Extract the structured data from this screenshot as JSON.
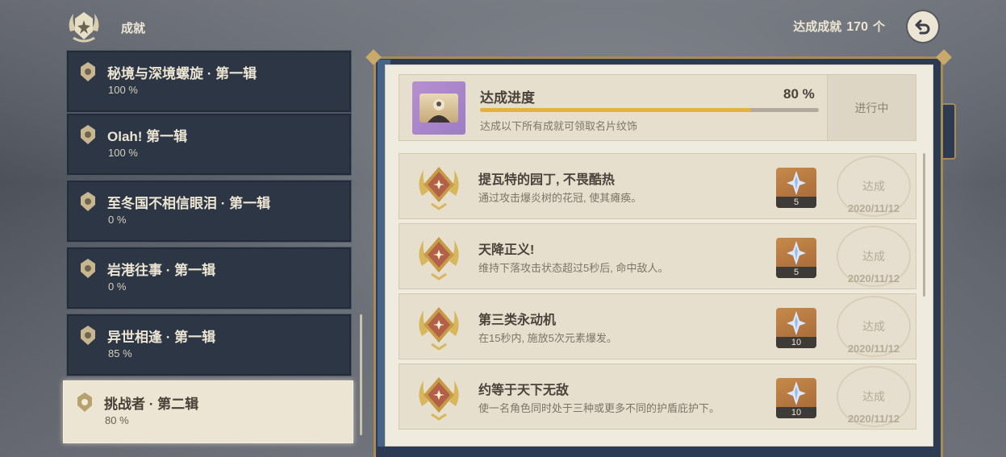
{
  "header": {
    "title": "成就",
    "achieved_label": "达成成就",
    "achieved_count": "170",
    "achieved_unit": "个"
  },
  "categories": [
    {
      "name": "秘境与深境螺旋 · 第一辑",
      "percent": "100 %",
      "active": false
    },
    {
      "name": "Olah! 第一辑",
      "percent": "100 %",
      "active": false
    },
    {
      "name": "至冬国不相信眼泪 · 第一辑",
      "percent": "0 %",
      "active": false
    },
    {
      "name": "岩港往事 · 第一辑",
      "percent": "0 %",
      "active": false
    },
    {
      "name": "异世相逢 · 第一辑",
      "percent": "85 %",
      "active": false
    },
    {
      "name": "挑战者 · 第二辑",
      "percent": "80 %",
      "active": true
    }
  ],
  "progress": {
    "label": "达成进度",
    "percent_text": "80 %",
    "fraction": 0.8,
    "description": "达成以下所有成就可领取名片纹饰",
    "status": "进行中"
  },
  "achievements": [
    {
      "title": "提瓦特的园丁, 不畏酷热",
      "description": "通过攻击爆炎树的花冠, 使其瘫痪。",
      "reward_qty": "5",
      "stamp": "达成",
      "date": "2020/11/12"
    },
    {
      "title": "天降正义!",
      "description": "维持下落攻击状态超过5秒后, 命中敌人。",
      "reward_qty": "5",
      "stamp": "达成",
      "date": "2020/11/12"
    },
    {
      "title": "第三类永动机",
      "description": "在15秒内, 施放5次元素爆发。",
      "reward_qty": "10",
      "stamp": "达成",
      "date": "2020/11/12"
    },
    {
      "title": "约等于天下无敌",
      "description": "使一名角色同时处于三种或更多不同的护盾庇护下。",
      "reward_qty": "10",
      "stamp": "达成",
      "date": "2020/11/12"
    }
  ],
  "colors": {
    "gold": "#e5b23e",
    "panel_dark": "#2c3645",
    "paper": "#e6dfce",
    "reward_bg": "#c58a4a"
  }
}
